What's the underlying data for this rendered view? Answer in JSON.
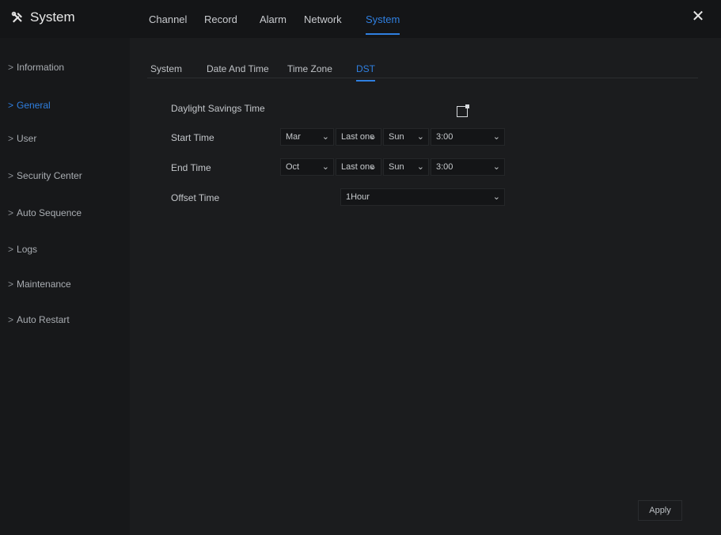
{
  "app": {
    "title": "System",
    "icon": "tools-icon"
  },
  "main_tabs": [
    {
      "label": "Channel"
    },
    {
      "label": "Record"
    },
    {
      "label": "Alarm"
    },
    {
      "label": "Network"
    },
    {
      "label": "System",
      "active": true
    }
  ],
  "sidebar": {
    "items": [
      {
        "label": "Information"
      },
      {
        "label": "General",
        "active": true
      },
      {
        "label": "User"
      },
      {
        "label": "Security Center"
      },
      {
        "label": "Auto Sequence"
      },
      {
        "label": "Logs"
      },
      {
        "label": "Maintenance"
      },
      {
        "label": "Auto Restart"
      }
    ]
  },
  "sub_tabs": [
    {
      "label": "System"
    },
    {
      "label": "Date And Time"
    },
    {
      "label": "Time Zone"
    },
    {
      "label": "DST",
      "active": true
    }
  ],
  "form": {
    "dst_label": "Daylight Savings Time",
    "dst_enabled": true,
    "start_label": "Start Time",
    "start": {
      "month": "Mar",
      "week": "Last one",
      "day": "Sun",
      "time": "3:00"
    },
    "end_label": "End Time",
    "end": {
      "month": "Oct",
      "week": "Last one",
      "day": "Sun",
      "time": "3:00"
    },
    "offset_label": "Offset Time",
    "offset": "1Hour"
  },
  "actions": {
    "apply": "Apply"
  },
  "colors": {
    "accent": "#2f7fe0",
    "background": "#1b1c1e"
  }
}
